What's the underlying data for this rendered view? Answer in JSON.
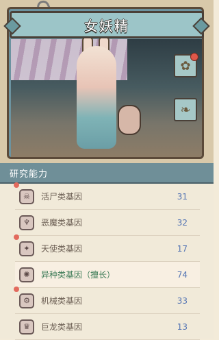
{
  "card": {
    "title": "女妖精"
  },
  "research": {
    "title": "研究能力",
    "items": [
      {
        "label": "活尸类基因",
        "value": "31",
        "icon": "zombie-gene-icon"
      },
      {
        "label": "恶魔类基因",
        "value": "32",
        "icon": "demon-gene-icon"
      },
      {
        "label": "天使类基因",
        "value": "17",
        "icon": "angel-gene-icon"
      },
      {
        "label": "异种类基因（擅长）",
        "value": "74",
        "icon": "alien-gene-icon",
        "highlight": true
      },
      {
        "label": "机械类基因",
        "value": "33",
        "icon": "mechanical-gene-icon"
      },
      {
        "label": "巨龙类基因",
        "value": "13",
        "icon": "dragon-gene-icon"
      }
    ]
  },
  "colors": {
    "accent": "#6f8f98",
    "value": "#5273b3",
    "highlight": "#3a7a55",
    "badge": "#e0584a"
  }
}
